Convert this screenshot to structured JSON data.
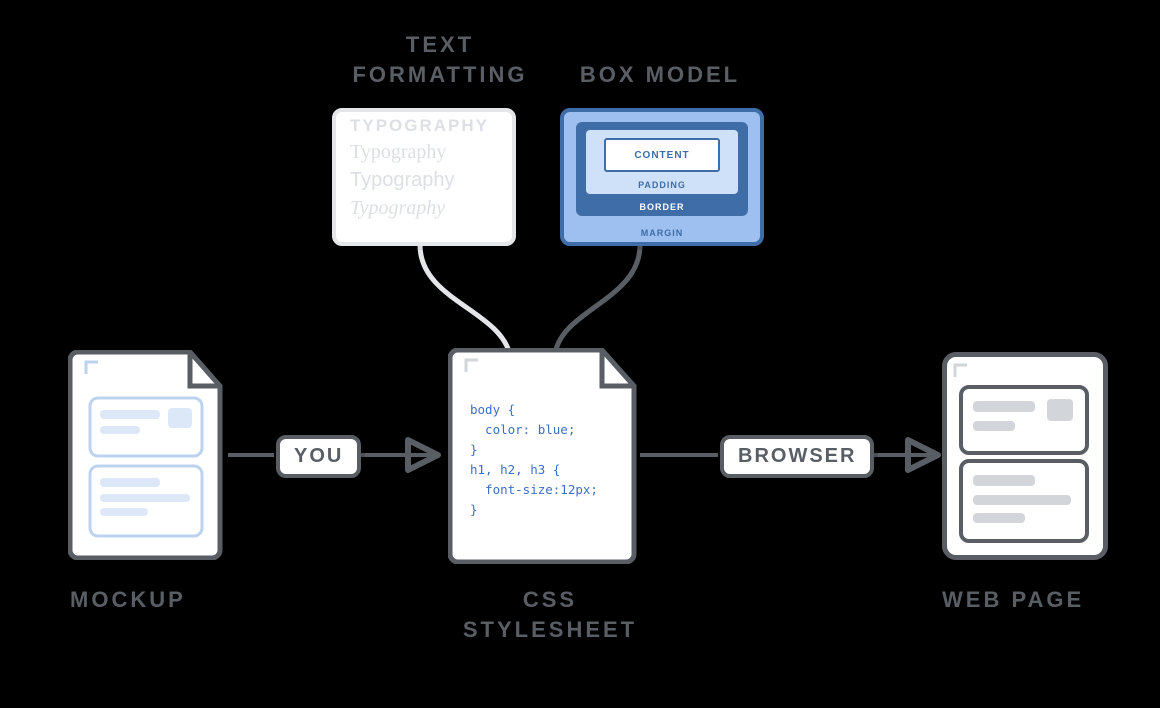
{
  "headings": {
    "text_formatting": "TEXT\nFORMATTING",
    "box_model": "BOX MODEL",
    "mockup": "MOCKUP",
    "css_stylesheet": "CSS\nSTYLESHEET",
    "web_page": "WEB PAGE"
  },
  "pills": {
    "you": "YOU",
    "browser": "BROWSER"
  },
  "typography_panel": {
    "rows": [
      "TYPOGRAPHY",
      "Typography",
      "Typography",
      "Typography"
    ]
  },
  "box_model_panel": {
    "content": "CONTENT",
    "padding": "PADDING",
    "border": "BORDER",
    "margin": "MARGIN"
  },
  "css_code": "body {\n  color: blue;\n}\nh1, h2, h3 {\n  font-size:12px;\n}",
  "colors": {
    "ink": "#595e65",
    "light": "#e4e6ea",
    "blue_line": "#3e6da7",
    "blue_fill": "#9dc0f0",
    "blue_pale": "#cfe1f8",
    "wire_blue": "#bcd3ef"
  }
}
